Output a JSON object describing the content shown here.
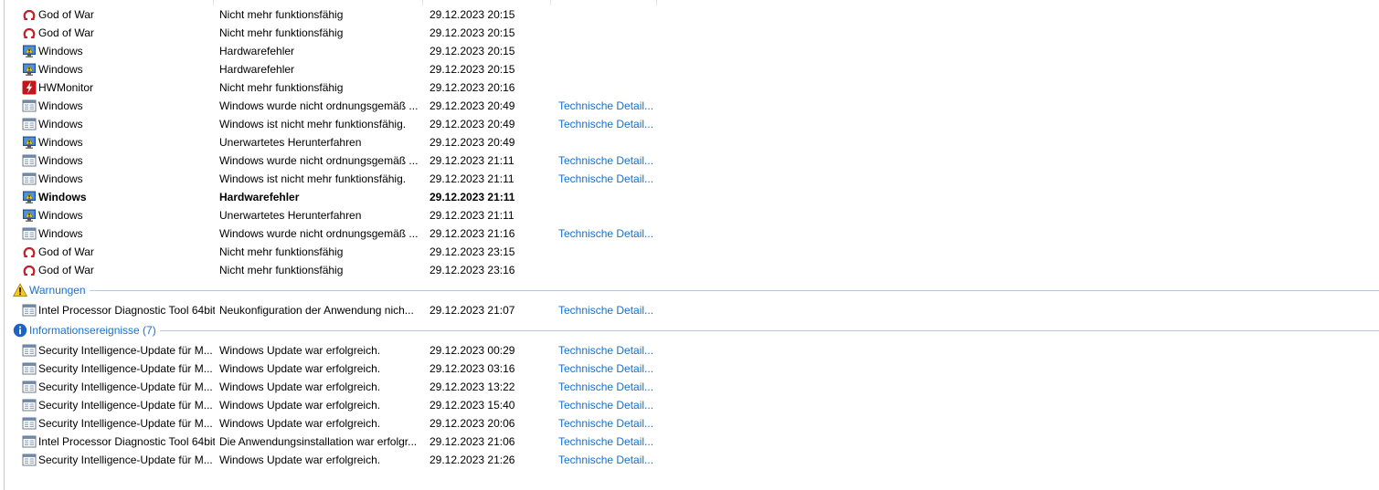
{
  "problems": [
    {
      "icon": "god-of-war-icon",
      "source": "God of War",
      "summary": "Nicht mehr funktionsfähig",
      "date": "29.12.2023 20:15",
      "action": ""
    },
    {
      "icon": "god-of-war-icon",
      "source": "God of War",
      "summary": "Nicht mehr funktionsfähig",
      "date": "29.12.2023 20:15",
      "action": ""
    },
    {
      "icon": "windows-monitor-icon",
      "source": "Windows",
      "summary": "Hardwarefehler",
      "date": "29.12.2023 20:15",
      "action": ""
    },
    {
      "icon": "windows-monitor-icon",
      "source": "Windows",
      "summary": "Hardwarefehler",
      "date": "29.12.2023 20:15",
      "action": ""
    },
    {
      "icon": "hwmonitor-icon",
      "source": "HWMonitor",
      "summary": "Nicht mehr funktionsfähig",
      "date": "29.12.2023 20:16",
      "action": ""
    },
    {
      "icon": "generic-app-icon",
      "source": "Windows",
      "summary": "Windows wurde nicht ordnungsgemäß ...",
      "date": "29.12.2023 20:49",
      "action": "Technische Detail..."
    },
    {
      "icon": "generic-app-icon",
      "source": "Windows",
      "summary": "Windows ist nicht mehr funktionsfähig.",
      "date": "29.12.2023 20:49",
      "action": "Technische Detail..."
    },
    {
      "icon": "windows-monitor-icon",
      "source": "Windows",
      "summary": "Unerwartetes Herunterfahren",
      "date": "29.12.2023 20:49",
      "action": ""
    },
    {
      "icon": "generic-app-icon",
      "source": "Windows",
      "summary": "Windows wurde nicht ordnungsgemäß ...",
      "date": "29.12.2023 21:11",
      "action": "Technische Detail..."
    },
    {
      "icon": "generic-app-icon",
      "source": "Windows",
      "summary": "Windows ist nicht mehr funktionsfähig.",
      "date": "29.12.2023 21:11",
      "action": "Technische Detail..."
    },
    {
      "icon": "windows-monitor-icon",
      "source": "Windows",
      "summary": "Hardwarefehler",
      "date": "29.12.2023 21:11",
      "action": "",
      "bold": true
    },
    {
      "icon": "windows-monitor-icon",
      "source": "Windows",
      "summary": "Unerwartetes Herunterfahren",
      "date": "29.12.2023 21:11",
      "action": ""
    },
    {
      "icon": "generic-app-icon",
      "source": "Windows",
      "summary": "Windows wurde nicht ordnungsgemäß ...",
      "date": "29.12.2023 21:16",
      "action": "Technische Detail..."
    },
    {
      "icon": "god-of-war-icon",
      "source": "God of War",
      "summary": "Nicht mehr funktionsfähig",
      "date": "29.12.2023 23:15",
      "action": ""
    },
    {
      "icon": "god-of-war-icon",
      "source": "God of War",
      "summary": "Nicht mehr funktionsfähig",
      "date": "29.12.2023 23:16",
      "action": ""
    }
  ],
  "warnings_group": {
    "label": "Warnungen",
    "icon": "warning-icon",
    "rows": [
      {
        "icon": "generic-app-icon",
        "source": "Intel Processor Diagnostic Tool 64bit",
        "summary": "Neukonfiguration der Anwendung nich...",
        "date": "29.12.2023 21:07",
        "action": "Technische Detail..."
      }
    ]
  },
  "info_group": {
    "label": "Informationsereignisse (7)",
    "icon": "info-icon",
    "rows": [
      {
        "icon": "generic-app-icon",
        "source": "Security Intelligence-Update für M...",
        "summary": "Windows Update war erfolgreich.",
        "date": "29.12.2023 00:29",
        "action": "Technische Detail..."
      },
      {
        "icon": "generic-app-icon",
        "source": "Security Intelligence-Update für M...",
        "summary": "Windows Update war erfolgreich.",
        "date": "29.12.2023 03:16",
        "action": "Technische Detail..."
      },
      {
        "icon": "generic-app-icon",
        "source": "Security Intelligence-Update für M...",
        "summary": "Windows Update war erfolgreich.",
        "date": "29.12.2023 13:22",
        "action": "Technische Detail..."
      },
      {
        "icon": "generic-app-icon",
        "source": "Security Intelligence-Update für M...",
        "summary": "Windows Update war erfolgreich.",
        "date": "29.12.2023 15:40",
        "action": "Technische Detail..."
      },
      {
        "icon": "generic-app-icon",
        "source": "Security Intelligence-Update für M...",
        "summary": "Windows Update war erfolgreich.",
        "date": "29.12.2023 20:06",
        "action": "Technische Detail..."
      },
      {
        "icon": "generic-app-icon",
        "source": "Intel Processor Diagnostic Tool 64bit",
        "summary": "Die Anwendungsinstallation war erfolgr...",
        "date": "29.12.2023 21:06",
        "action": "Technische Detail..."
      },
      {
        "icon": "generic-app-icon",
        "source": "Security Intelligence-Update für M...",
        "summary": "Windows Update war erfolgreich.",
        "date": "29.12.2023 21:26",
        "action": "Technische Detail..."
      }
    ]
  },
  "colors": {
    "link": "#1a6fc9",
    "group_line": "#b9c9dc"
  }
}
